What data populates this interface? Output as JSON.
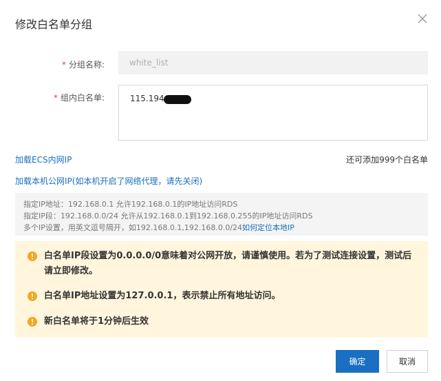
{
  "dialog": {
    "title": "修改白名单分组",
    "close_icon": "close-icon"
  },
  "form": {
    "group_name": {
      "required_mark": "*",
      "label": "分组名称:",
      "value": "white_list"
    },
    "ip_list": {
      "required_mark": "*",
      "label": "组内白名单:",
      "value": "115.194.1"
    }
  },
  "links": {
    "add_ecs": "加载ECS内网IP",
    "add_public": "加载本机公网IP(如本机开启了网络代理，请先关闭)"
  },
  "remaining": "还可添加999个白名单",
  "hint": {
    "line1": "指定IP地址：192.168.0.1 允许192.168.0.1的IP地址访问RDS",
    "line2": "指定IP段：192.168.0.0/24 允许从192.168.0.1到192.168.0.255的IP地址访问RDS",
    "line3": "多个IP设置，用英文逗号隔开，如192.168.0.1,192.168.0.0/24",
    "line3_link": "如何定位本地IP"
  },
  "warnings": [
    "白名单IP段设置为0.0.0.0/0意味着对公网开放，请谨慎使用。若为了测试连接设置，测试后请立即修改。",
    "白名单IP地址设置为127.0.0.1，表示禁止所有地址访问。",
    "新白名单将于1分钟后生效"
  ],
  "colors": {
    "accent": "#1a6fc2",
    "warning_icon": "#f5a623",
    "warning_bg": "#fff6dd",
    "required": "#e24b38"
  },
  "buttons": {
    "confirm": "确定",
    "cancel": "取消"
  }
}
